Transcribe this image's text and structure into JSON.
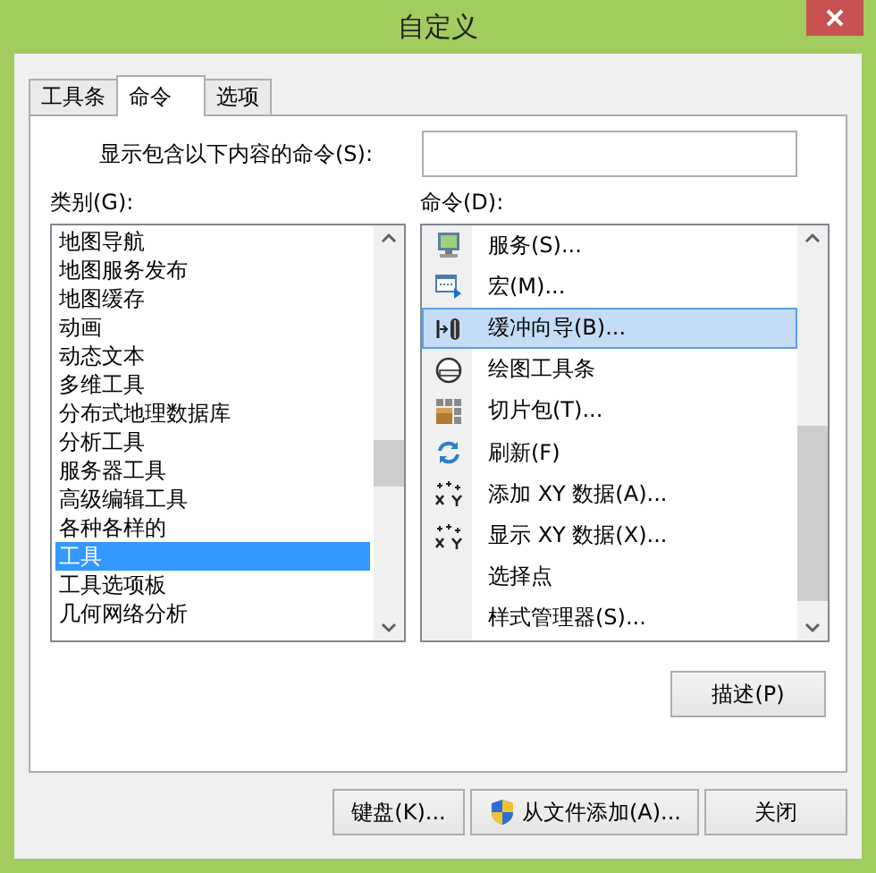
{
  "window": {
    "title": "自定义"
  },
  "tabs": [
    {
      "label": "工具条",
      "selected": false
    },
    {
      "label": "命令",
      "selected": true
    },
    {
      "label": "选项",
      "selected": false
    }
  ],
  "search": {
    "label": "显示包含以下内容的命令(S):"
  },
  "categories": {
    "label": "类别(G):",
    "items": [
      {
        "label": "地图导航",
        "selected": false
      },
      {
        "label": "地图服务发布",
        "selected": false
      },
      {
        "label": "地图缓存",
        "selected": false
      },
      {
        "label": "动画",
        "selected": false
      },
      {
        "label": "动态文本",
        "selected": false
      },
      {
        "label": "多维工具",
        "selected": false
      },
      {
        "label": "分布式地理数据库",
        "selected": false
      },
      {
        "label": "分析工具",
        "selected": false
      },
      {
        "label": "服务器工具",
        "selected": false
      },
      {
        "label": "高级编辑工具",
        "selected": false
      },
      {
        "label": "各种各样的",
        "selected": false
      },
      {
        "label": "工具",
        "selected": true
      },
      {
        "label": "工具选项板",
        "selected": false
      },
      {
        "label": "几何网络分析",
        "selected": false
      }
    ]
  },
  "commands": {
    "label": "命令(D):",
    "items": [
      {
        "label": "服务(S)...",
        "kind": "monitor",
        "selected": false
      },
      {
        "label": "宏(M)...",
        "kind": "window",
        "selected": false
      },
      {
        "label": "缓冲向导(B)...",
        "kind": "buffer",
        "selected": true
      },
      {
        "label": "绘图工具条",
        "kind": "circle",
        "selected": false
      },
      {
        "label": "切片包(T)...",
        "kind": "grid",
        "selected": false
      },
      {
        "label": "刷新(F)",
        "kind": "refresh",
        "selected": false
      },
      {
        "label": "添加 XY 数据(A)...",
        "kind": "xy",
        "selected": false
      },
      {
        "label": "显示 XY 数据(X)...",
        "kind": "xy",
        "selected": false
      },
      {
        "label": "选择点",
        "kind": "none",
        "selected": false
      },
      {
        "label": "样式管理器(S)...",
        "kind": "none",
        "selected": false
      }
    ]
  },
  "describe_button": "描述(P)",
  "buttons": [
    {
      "label": "键盘(K)...",
      "kind": "plain"
    },
    {
      "label": "从文件添加(A)...",
      "kind": "shield"
    },
    {
      "label": "关闭",
      "kind": "plain"
    }
  ]
}
